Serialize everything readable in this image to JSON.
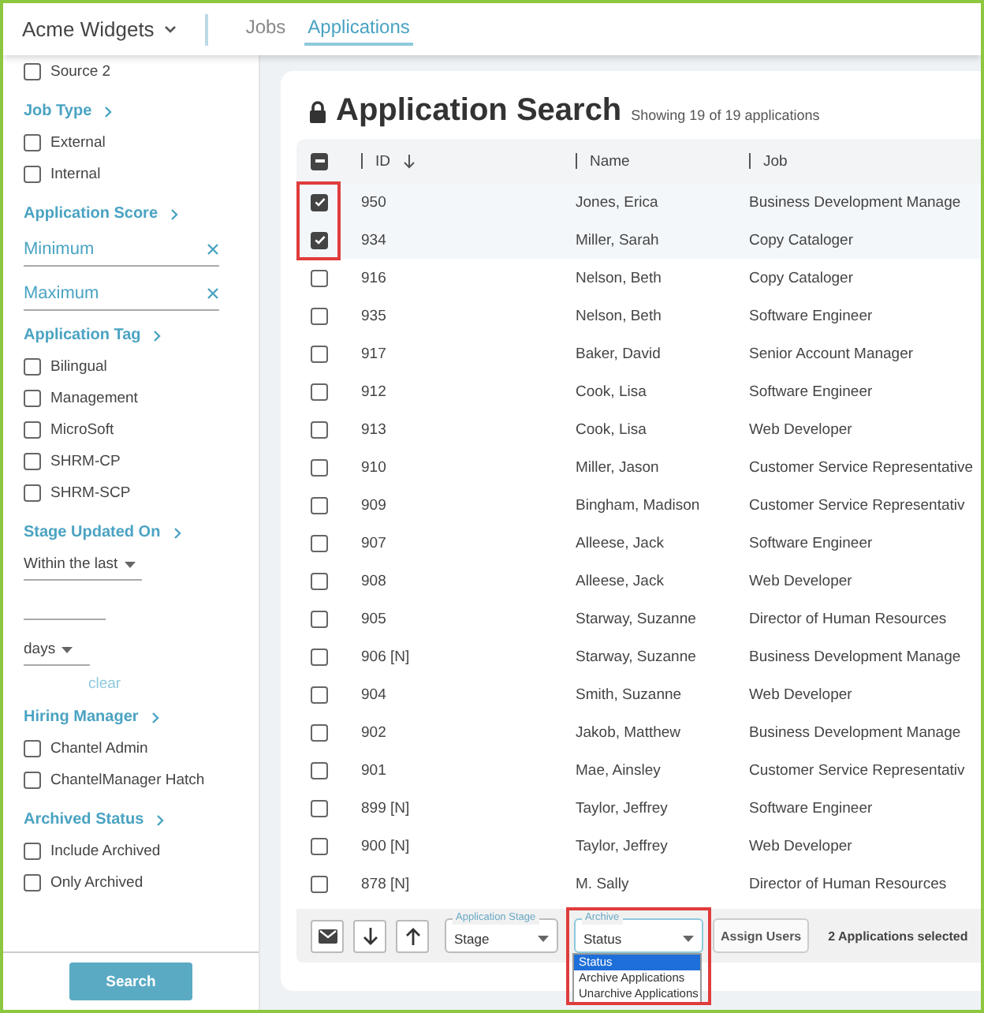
{
  "topbar": {
    "brand": "Acme Widgets",
    "tabs": [
      {
        "label": "Jobs",
        "selected": false
      },
      {
        "label": "Applications",
        "selected": true
      }
    ]
  },
  "sidebar": {
    "sections": [
      {
        "controls": [
          {
            "kind": "checkbox",
            "label": "Source 2",
            "checked": false
          }
        ]
      },
      {
        "title": "Job Type",
        "controls": [
          {
            "kind": "checkbox",
            "label": "External",
            "checked": false
          },
          {
            "kind": "checkbox",
            "label": "Internal",
            "checked": false
          }
        ]
      },
      {
        "title": "Application Score",
        "controls": [
          {
            "kind": "field",
            "placeholder": "Minimum"
          },
          {
            "kind": "field",
            "placeholder": "Maximum"
          }
        ]
      },
      {
        "title": "Application Tag",
        "controls": [
          {
            "kind": "checkbox",
            "label": "Bilingual",
            "checked": false
          },
          {
            "kind": "checkbox",
            "label": "Management",
            "checked": false
          },
          {
            "kind": "checkbox",
            "label": "MicroSoft",
            "checked": false
          },
          {
            "kind": "checkbox",
            "label": "SHRM-CP",
            "checked": false
          },
          {
            "kind": "checkbox",
            "label": "SHRM-SCP",
            "checked": false
          }
        ]
      },
      {
        "title": "Stage Updated On",
        "controls": [
          {
            "kind": "select",
            "value": "Within the last"
          },
          {
            "kind": "blank"
          },
          {
            "kind": "select",
            "value": "days"
          },
          {
            "kind": "link",
            "label": "clear"
          }
        ]
      },
      {
        "title": "Hiring Manager",
        "controls": [
          {
            "kind": "checkbox",
            "label": "Chantel Admin",
            "checked": false
          },
          {
            "kind": "checkbox",
            "label": "ChantelManager Hatch",
            "checked": false
          }
        ]
      },
      {
        "title": "Archived Status",
        "controls": [
          {
            "kind": "checkbox",
            "label": "Include Archived",
            "checked": false
          },
          {
            "kind": "checkbox",
            "label": "Only Archived",
            "checked": false
          }
        ]
      }
    ],
    "search_button": "Search"
  },
  "main": {
    "title": "Application Search",
    "subtitle": "Showing 19 of 19 applications",
    "table": {
      "select_all_partial": true,
      "columns": [
        {
          "label": "ID",
          "sorted": true
        },
        {
          "label": "Name",
          "sorted": false
        },
        {
          "label": "Job",
          "sorted": false
        }
      ],
      "rows": [
        {
          "id": "950",
          "name": "Jones, Erica",
          "job": "Business Development Manage",
          "selected": true
        },
        {
          "id": "934",
          "name": "Miller, Sarah",
          "job": "Copy Cataloger",
          "selected": true
        },
        {
          "id": "916",
          "name": "Nelson, Beth",
          "job": "Copy Cataloger",
          "selected": false
        },
        {
          "id": "935",
          "name": "Nelson, Beth",
          "job": "Software Engineer",
          "selected": false
        },
        {
          "id": "917",
          "name": "Baker, David",
          "job": "Senior Account Manager",
          "selected": false
        },
        {
          "id": "912",
          "name": "Cook, Lisa",
          "job": "Software Engineer",
          "selected": false
        },
        {
          "id": "913",
          "name": "Cook, Lisa",
          "job": "Web Developer",
          "selected": false
        },
        {
          "id": "910",
          "name": "Miller, Jason",
          "job": "Customer Service Representative",
          "selected": false
        },
        {
          "id": "909",
          "name": "Bingham, Madison",
          "job": "Customer Service Representativ",
          "selected": false
        },
        {
          "id": "907",
          "name": "Alleese, Jack",
          "job": "Software Engineer",
          "selected": false
        },
        {
          "id": "908",
          "name": "Alleese, Jack",
          "job": "Web Developer",
          "selected": false
        },
        {
          "id": "905",
          "name": "Starway, Suzanne",
          "job": "Director of Human Resources",
          "selected": false
        },
        {
          "id": "906 [N]",
          "name": "Starway, Suzanne",
          "job": "Business Development Manage",
          "selected": false
        },
        {
          "id": "904",
          "name": "Smith, Suzanne",
          "job": "Web Developer",
          "selected": false
        },
        {
          "id": "902",
          "name": "Jakob, Matthew",
          "job": "Business Development Manage",
          "selected": false
        },
        {
          "id": "901",
          "name": "Mae, Ainsley",
          "job": "Customer Service Representativ",
          "selected": false
        },
        {
          "id": "899 [N]",
          "name": "Taylor, Jeffrey",
          "job": "Software Engineer",
          "selected": false
        },
        {
          "id": "900 [N]",
          "name": "Taylor, Jeffrey",
          "job": "Web Developer",
          "selected": false
        },
        {
          "id": "878 [N]",
          "name": "M. Sally",
          "job": "Director of Human Resources",
          "selected": false
        }
      ]
    },
    "action_bar": {
      "stage_select": {
        "label": "Application Stage",
        "value": "Stage"
      },
      "archive_select": {
        "label": "Archive",
        "value": "Status",
        "expanded": true,
        "options": [
          {
            "label": "Status",
            "selected": true
          },
          {
            "label": "Archive Applications",
            "selected": false
          },
          {
            "label": "Unarchive Applications",
            "selected": false
          }
        ]
      },
      "assign_button": "Assign Users",
      "selection_text": "2 Applications selected"
    }
  }
}
